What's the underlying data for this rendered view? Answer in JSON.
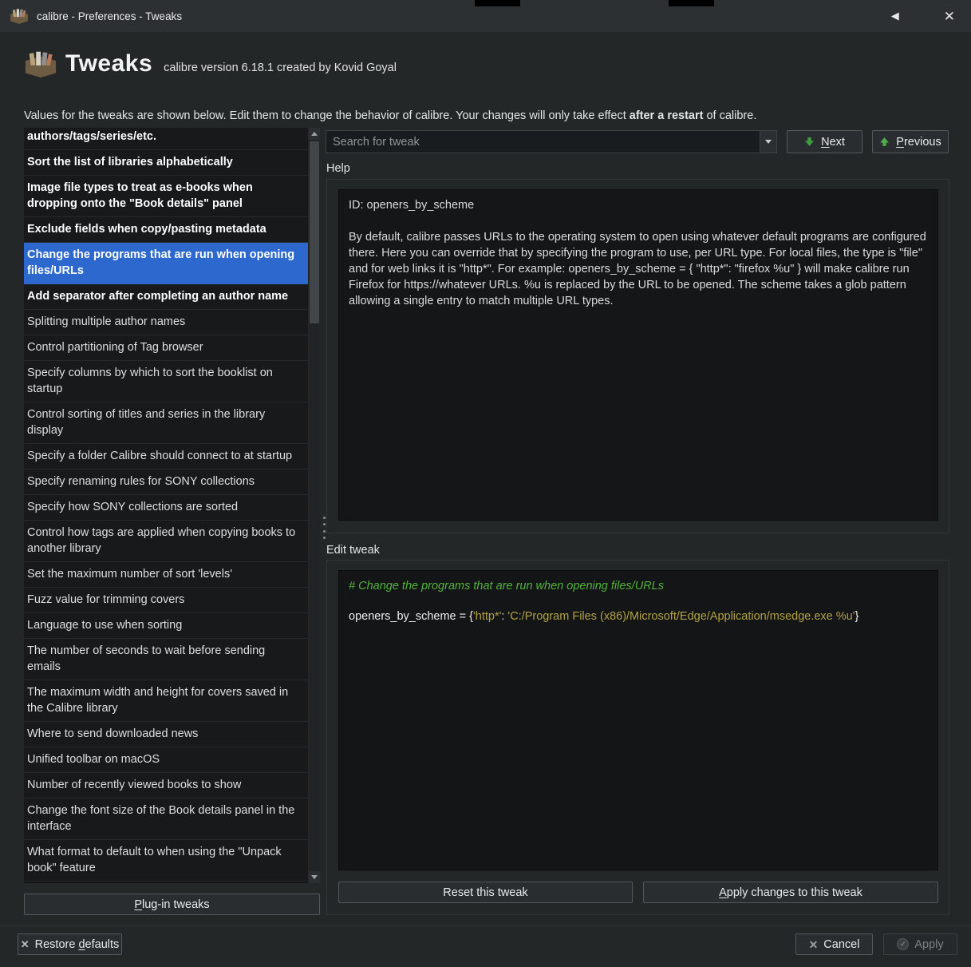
{
  "window": {
    "title": "calibre - Preferences - Tweaks"
  },
  "header": {
    "title": "Tweaks",
    "subtitle": "calibre version 6.18.1 created by Kovid Goyal"
  },
  "description": {
    "pre": "Values for the tweaks are shown below. Edit them to change the behavior of calibre. Your changes will only take effect ",
    "bold": "after a restart",
    "post": " of calibre."
  },
  "tweaks_list": {
    "items": [
      {
        "text": "authors/tags/series/etc.",
        "bold": true,
        "partial": true
      },
      {
        "text": "Sort the list of libraries alphabetically",
        "bold": true
      },
      {
        "text": "Image file types to treat as e-books when dropping onto the \"Book details\" panel",
        "bold": true
      },
      {
        "text": "Exclude fields when copy/pasting metadata",
        "bold": true
      },
      {
        "text": "Change the programs that are run when opening files/URLs",
        "bold": true,
        "selected": true
      },
      {
        "text": "Add separator after completing an author name",
        "bold": true
      },
      {
        "text": "Splitting multiple author names"
      },
      {
        "text": "Control partitioning of Tag browser"
      },
      {
        "text": "Specify columns by which to sort the booklist on startup"
      },
      {
        "text": "Control sorting of titles and series in the library display"
      },
      {
        "text": "Specify a folder Calibre should connect to at startup"
      },
      {
        "text": "Specify renaming rules for SONY collections"
      },
      {
        "text": "Specify how SONY collections are sorted"
      },
      {
        "text": "Control how tags are applied when copying books to another library"
      },
      {
        "text": "Set the maximum number of sort 'levels'"
      },
      {
        "text": "Fuzz value for trimming covers"
      },
      {
        "text": "Language to use when sorting"
      },
      {
        "text": "The number of seconds to wait before sending emails"
      },
      {
        "text": "The maximum width and height for covers saved in the Calibre library"
      },
      {
        "text": "Where to send downloaded news"
      },
      {
        "text": "Unified toolbar on macOS"
      },
      {
        "text": "Number of recently viewed books to show"
      },
      {
        "text": "Change the font size of the Book details panel in the interface"
      },
      {
        "text": "What format to default to when using the \"Unpack book\" feature"
      }
    ]
  },
  "plugin_tweaks_button": {
    "label": "Plug-in tweaks",
    "mnemonic": "P"
  },
  "search": {
    "placeholder": "Search for tweak",
    "next": {
      "label": "Next",
      "mnemonic": "N"
    },
    "previous": {
      "label": "Previous",
      "mnemonic": "P"
    }
  },
  "help": {
    "label": "Help",
    "id_line": "ID: openers_by_scheme",
    "body": "By default, calibre passes URLs to the operating system to open using whatever default programs are configured there. Here you can override that by specifying the program to use, per URL type. For local files, the type is \"file\" and for web links it is \"http*\". For example: openers_by_scheme = { \"http*\": \"firefox %u\" } will make calibre run Firefox for https://whatever URLs. %u is replaced by the URL to be opened. The scheme takes a glob pattern allowing a single entry to match multiple URL types."
  },
  "edit": {
    "label": "Edit tweak",
    "comment": "# Change the programs that are run when opening files/URLs",
    "code": {
      "pre": "openers_by_scheme = {",
      "str1": "'http*'",
      "sep": ": ",
      "str2": "'C:/Program Files (x86)/Microsoft/Edge/Application/msedge.exe %u'",
      "post": "}"
    },
    "reset_button": {
      "label": "Reset this tweak"
    },
    "apply_button": {
      "label": "Apply changes to this tweak",
      "mnemonic": "A"
    }
  },
  "footer": {
    "restore_defaults": {
      "label": "Restore defaults",
      "mnemonic": "d"
    },
    "cancel": {
      "label": "Cancel"
    },
    "apply": {
      "label": "Apply"
    }
  },
  "colors": {
    "selection": "#2d68cf",
    "comment_green": "#54b33c",
    "string_yellow": "#b3a243"
  }
}
